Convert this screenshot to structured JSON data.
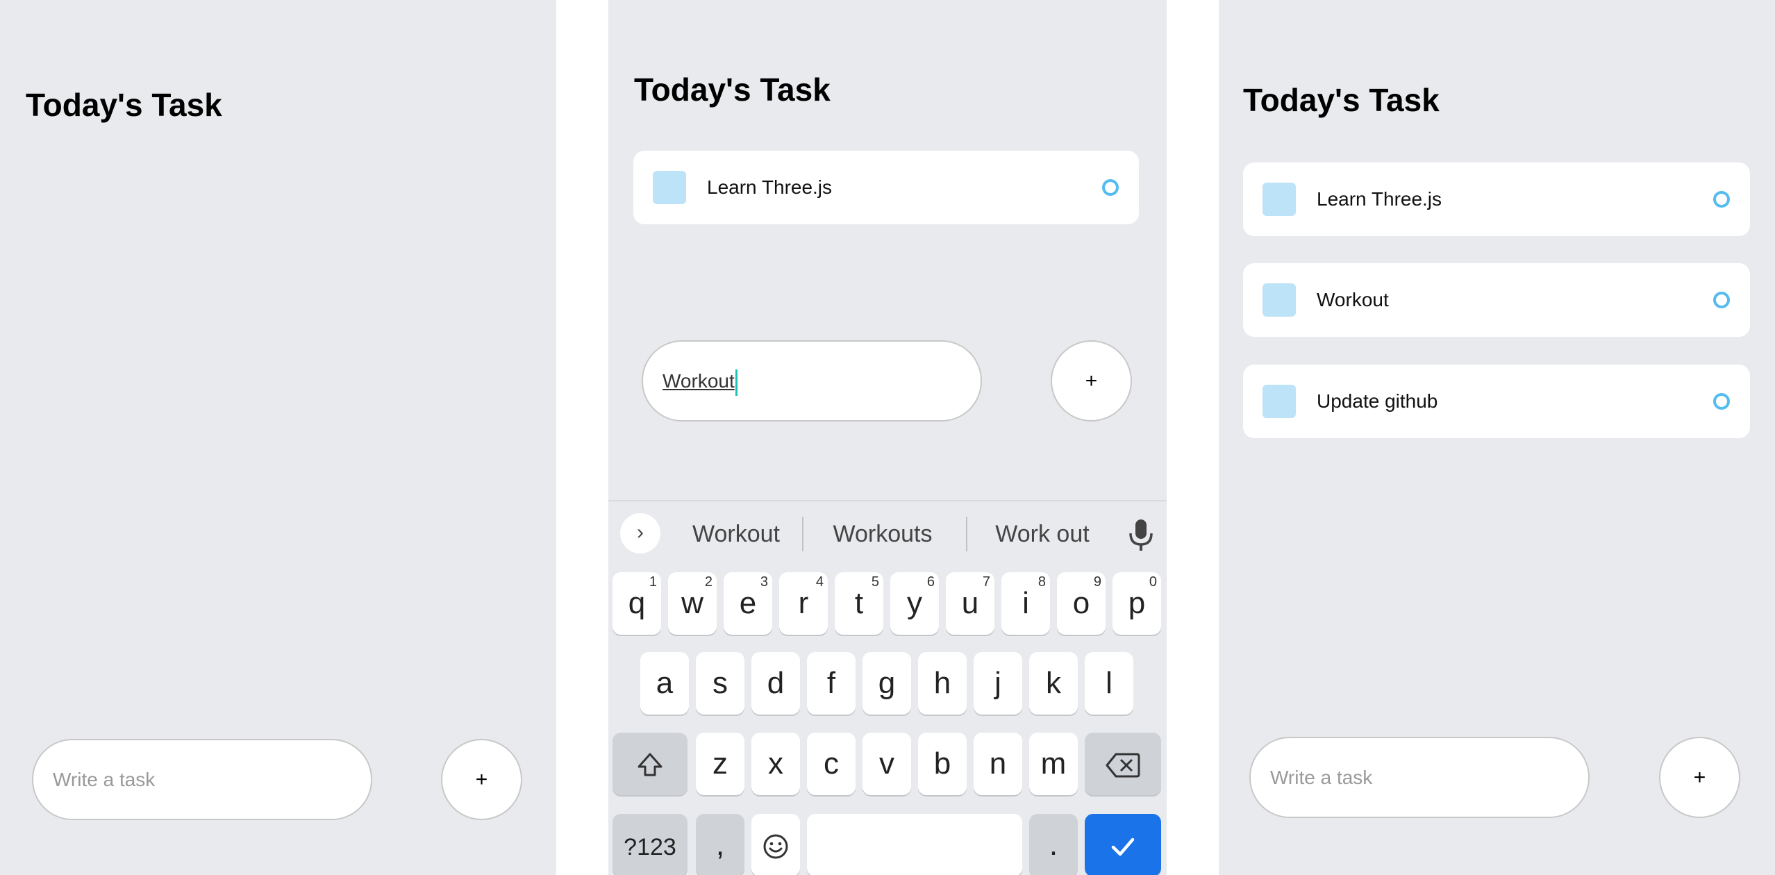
{
  "screen1": {
    "title": "Today's Task",
    "input_placeholder": "Write a task",
    "add_label": "+"
  },
  "screen2": {
    "title": "Today's Task",
    "tasks": [
      {
        "text": "Learn Three.js"
      }
    ],
    "input_value": "Workout",
    "add_label": "+",
    "keyboard": {
      "suggestions": [
        "Workout",
        "Workouts",
        "Work out"
      ],
      "row1": [
        {
          "key": "q",
          "hint": "1"
        },
        {
          "key": "w",
          "hint": "2"
        },
        {
          "key": "e",
          "hint": "3"
        },
        {
          "key": "r",
          "hint": "4"
        },
        {
          "key": "t",
          "hint": "5"
        },
        {
          "key": "y",
          "hint": "6"
        },
        {
          "key": "u",
          "hint": "7"
        },
        {
          "key": "i",
          "hint": "8"
        },
        {
          "key": "o",
          "hint": "9"
        },
        {
          "key": "p",
          "hint": "0"
        }
      ],
      "row2": [
        "a",
        "s",
        "d",
        "f",
        "g",
        "h",
        "j",
        "k",
        "l"
      ],
      "row3": [
        "z",
        "x",
        "c",
        "v",
        "b",
        "n",
        "m"
      ],
      "row4": {
        "symbols": "?123",
        "comma": ",",
        "period": "."
      }
    }
  },
  "screen3": {
    "title": "Today's Task",
    "tasks": [
      {
        "text": "Learn Three.js"
      },
      {
        "text": "Workout"
      },
      {
        "text": "Update github"
      }
    ],
    "input_placeholder": "Write a task",
    "add_label": "+"
  },
  "colors": {
    "background": "#e8eaed",
    "card": "#ffffff",
    "task_square": "#bde3f8",
    "task_circle": "#55bcef",
    "keyboard_action": "#1a73e8",
    "caret": "#1fc2b6"
  }
}
